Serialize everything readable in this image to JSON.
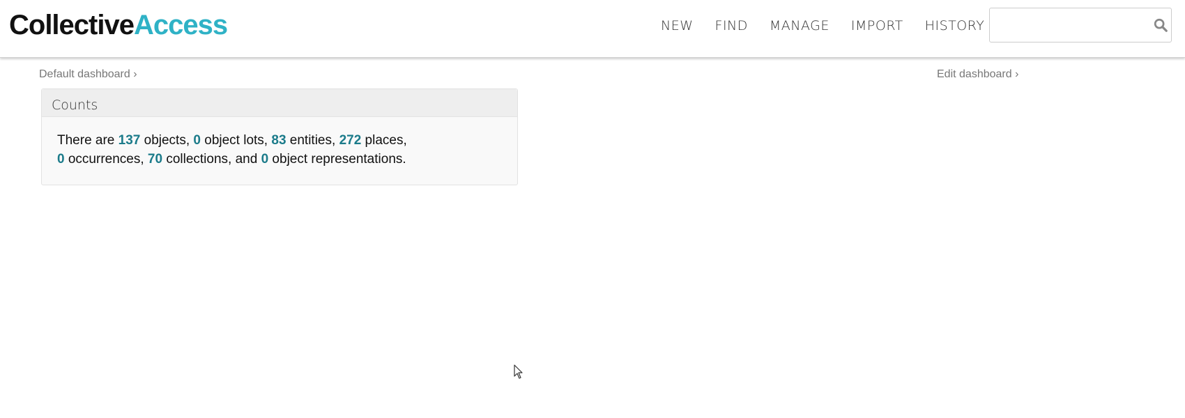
{
  "logo": {
    "part1": "Collective",
    "part2": "Access",
    "colors": {
      "part1": "#111111",
      "part2": "#2fb2c6"
    }
  },
  "nav": {
    "items": [
      {
        "label": "NEW"
      },
      {
        "label": "FIND"
      },
      {
        "label": "MANAGE"
      },
      {
        "label": "IMPORT"
      },
      {
        "label": "HISTORY"
      }
    ]
  },
  "search": {
    "value": "",
    "placeholder": "",
    "icon": "search-icon"
  },
  "breadcrumbs": {
    "left": "Default dashboard ›",
    "right": "Edit dashboard ›"
  },
  "widget": {
    "title": "Counts",
    "counts": {
      "t0": "There are ",
      "objects": "137",
      "t1": " objects, ",
      "object_lots": "0",
      "t2": " object lots, ",
      "entities": "83",
      "t3": " entities, ",
      "places": "272",
      "t4": " places,",
      "occurrences": "0",
      "t5": " occurrences, ",
      "collections": "70",
      "t6": " collections, and ",
      "object_representations": "0",
      "t7": " object representations."
    },
    "colors": {
      "number": "#1b7b8a"
    }
  }
}
